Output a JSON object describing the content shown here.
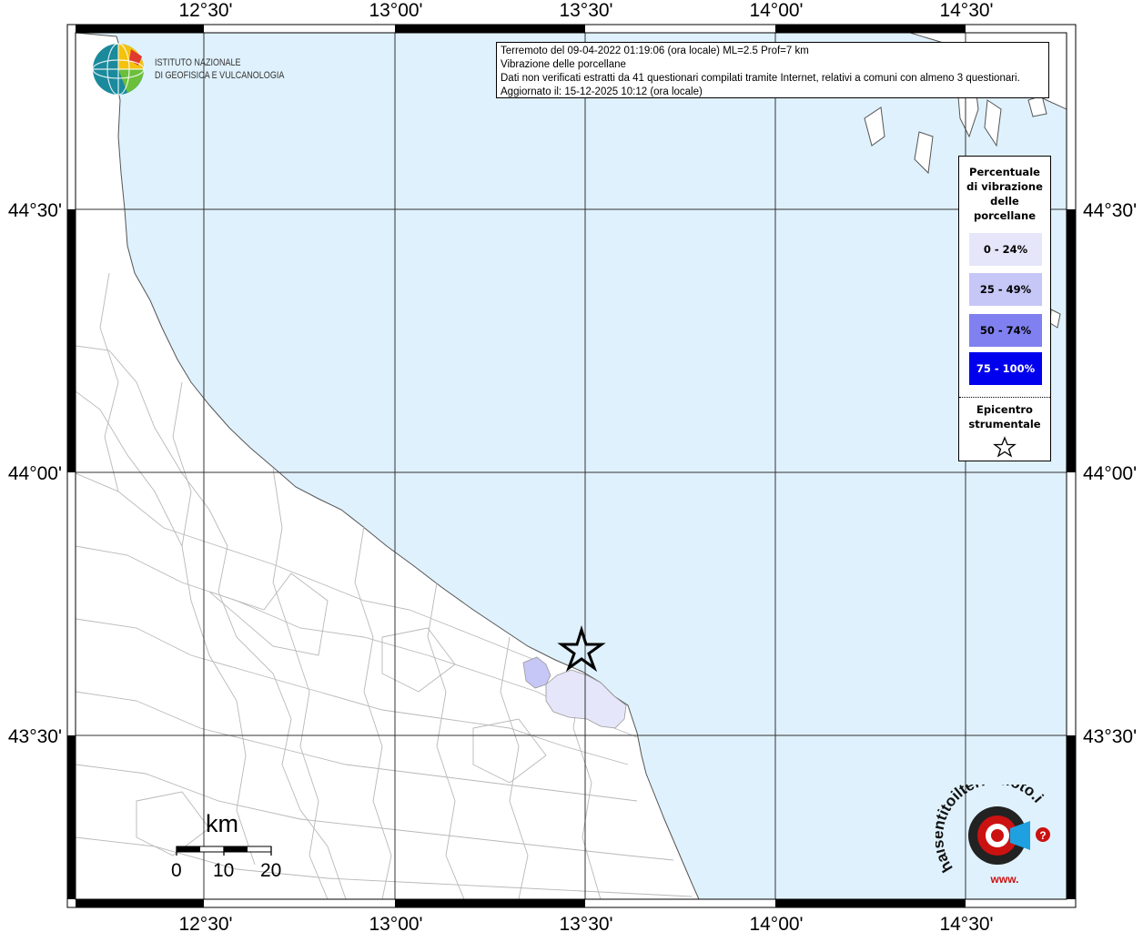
{
  "header": {
    "line1": "Terremoto del 09-04-2022 01:19:06 (ora locale) ML=2.5 Prof=7 km",
    "line2": "Vibrazione delle porcellane",
    "line3": "Dati non verificati estratti da 41 questionari compilati tramite Internet, relativi a comuni con almeno 3 questionari.",
    "line4": "Aggiornato il: 15-12-2025 10:12 (ora locale)"
  },
  "axes": {
    "lon_labels": [
      "12°30'",
      "13°00'",
      "13°30'",
      "14°00'",
      "14°30'"
    ],
    "lat_labels": [
      "44°30'",
      "44°00'",
      "43°30'"
    ]
  },
  "legend": {
    "title_lines": [
      "Percentuale",
      "di vibrazione",
      "delle",
      "porcellane"
    ],
    "items": [
      {
        "label": "0 - 24%",
        "color": "#e6e6fa"
      },
      {
        "label": "25 - 49%",
        "color": "#c6c6f7"
      },
      {
        "label": "50 - 74%",
        "color": "#8080f0"
      },
      {
        "label": "75 - 100%",
        "color": "#0000ee"
      }
    ],
    "epicenter_lines": [
      "Epicentro",
      "strumentale"
    ]
  },
  "scale": {
    "title": "km",
    "labels": [
      "0",
      "10",
      "20"
    ]
  },
  "logos": {
    "ingv_line1": "ISTITUTO NAZIONALE",
    "ingv_line2": "DI GEOFISICA E VULCANOLOGIA",
    "haisentito": "haisentitoilterremoto.it",
    "www": "www."
  },
  "colors": {
    "sea": "#dff1fc",
    "land": "#ffffff",
    "grid": "#333333",
    "municipality_border": "#b8b8b8",
    "range_0_24": "#e6e6fa",
    "range_25_49": "#c6c6f7"
  }
}
